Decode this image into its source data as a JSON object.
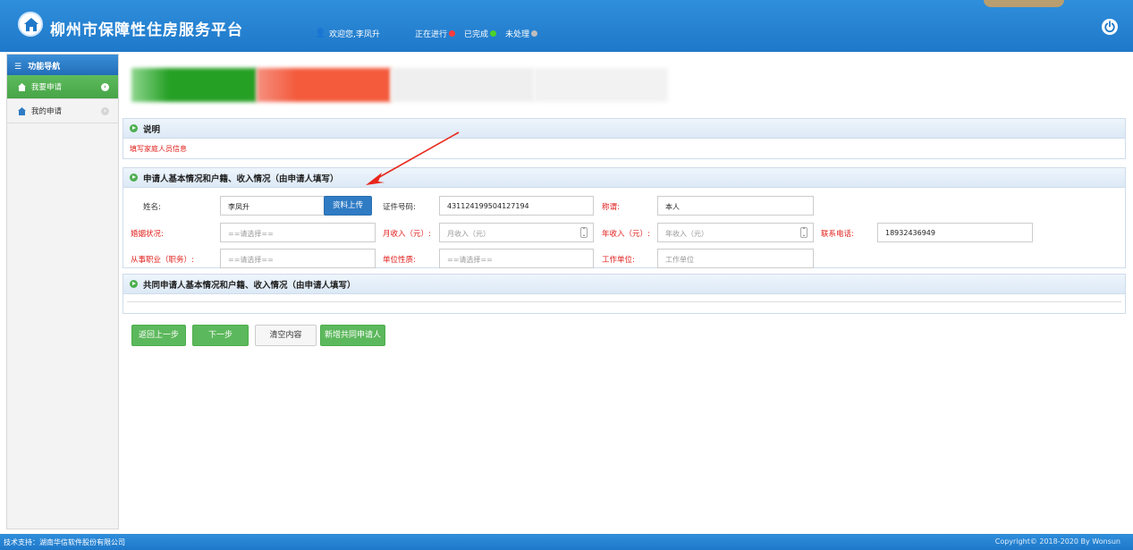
{
  "header": {
    "title": "柳州市保障性住房服务平台",
    "welcome": "欢迎您,李凤升",
    "statuses": [
      {
        "label": "正在进行",
        "color": "#ff3b3b"
      },
      {
        "label": "已完成",
        "color": "#4cd22a"
      },
      {
        "label": "未处理",
        "color": "#bdbdbd"
      }
    ]
  },
  "sidebar": {
    "title": "功能导航",
    "items": [
      {
        "label": "我要申请",
        "active": true
      },
      {
        "label": "我的申请",
        "active": false
      }
    ]
  },
  "panels": {
    "note_title": "说明",
    "note_text": "填写家庭人员信息",
    "applicant_title": "申请人基本情况和户籍、收入情况（由申请人填写）",
    "co_applicant_title": "共同申请人基本情况和户籍、收入情况（由申请人填写）"
  },
  "form": {
    "name_label": "姓名:",
    "name_value": "李凤升",
    "upload_label": "资料上传",
    "id_label": "证件号码:",
    "id_value": "431124199504127194",
    "title_label": "称谓:",
    "title_value": "本人",
    "marital_label": "婚姻状况:",
    "marital_placeholder": "==请选择==",
    "monthly_label": "月收入（元）:",
    "monthly_placeholder": "月收入（元）",
    "annual_label": "年收入（元）:",
    "annual_placeholder": "年收入（元）",
    "phone_label": "联系电话:",
    "phone_value": "18932436949",
    "occupation_label": "从事职业（职务）:",
    "occupation_placeholder": "==请选择==",
    "unit_nature_label": "单位性质:",
    "unit_nature_placeholder": "==请选择==",
    "workplace_label": "工作单位:",
    "workplace_placeholder": "工作单位"
  },
  "buttons": {
    "back": "返回上一步",
    "next": "下一步",
    "clear": "清空内容",
    "add_co": "新增共同申请人"
  },
  "footer": {
    "left": "技术支持：湖南华信软件股份有限公司",
    "right": "Copyright© 2018-2020 By Wonsun"
  }
}
